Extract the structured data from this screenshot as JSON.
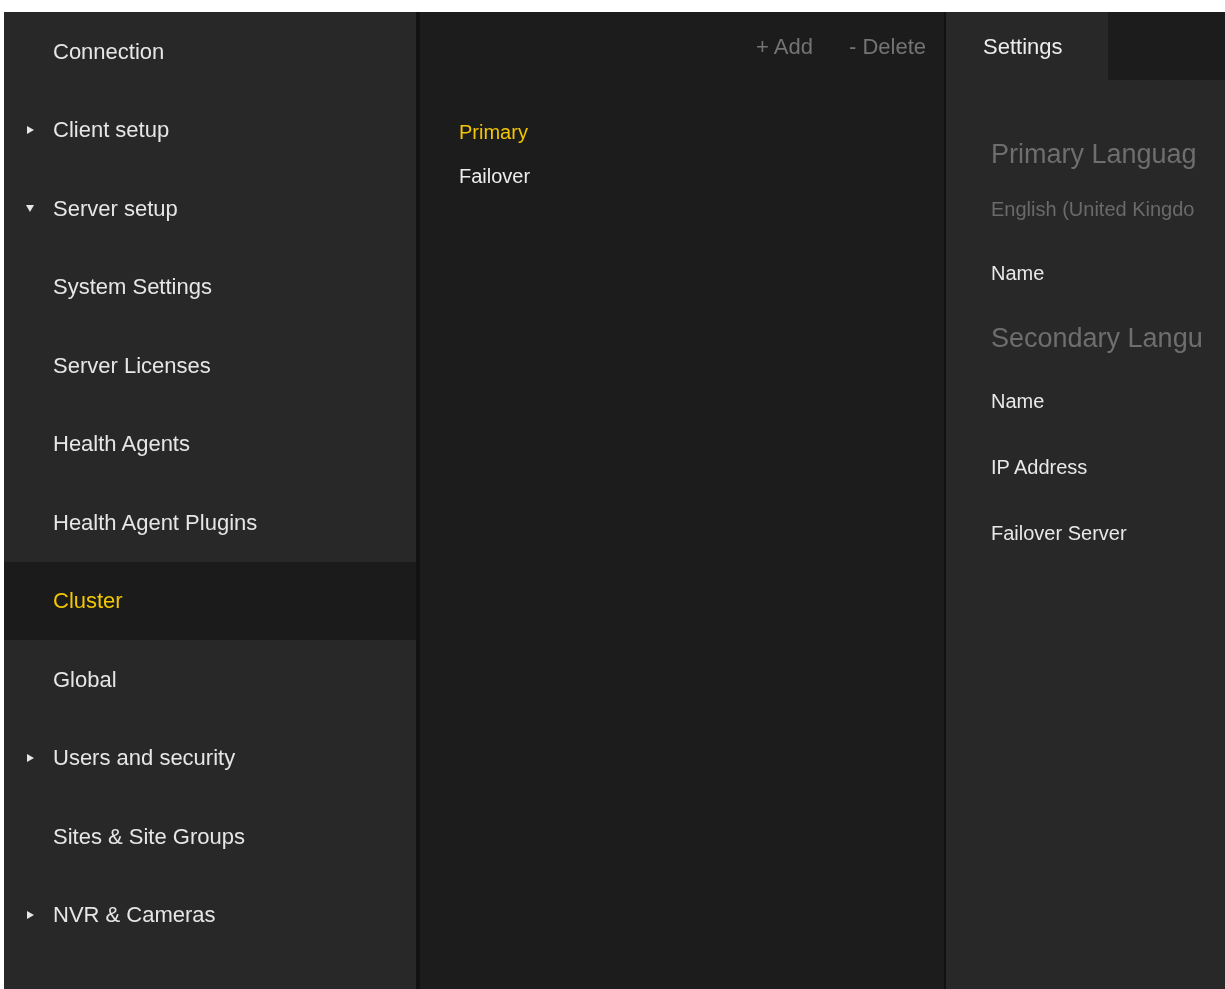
{
  "sidebar": {
    "items": [
      {
        "label": "Connection",
        "kind": "page",
        "selected": false
      },
      {
        "label": "Client setup",
        "kind": "group",
        "expanded": false,
        "selected": false
      },
      {
        "label": "Server setup",
        "kind": "group",
        "expanded": true,
        "selected": false
      },
      {
        "label": "System Settings",
        "kind": "page",
        "selected": false
      },
      {
        "label": "Server Licenses",
        "kind": "page",
        "selected": false
      },
      {
        "label": "Health Agents",
        "kind": "page",
        "selected": false
      },
      {
        "label": "Health Agent Plugins",
        "kind": "page",
        "selected": false
      },
      {
        "label": "Cluster",
        "kind": "page",
        "selected": true
      },
      {
        "label": "Global",
        "kind": "page",
        "selected": false
      },
      {
        "label": "Users and security",
        "kind": "group",
        "expanded": false,
        "selected": false
      },
      {
        "label": "Sites & Site Groups",
        "kind": "page",
        "selected": false
      },
      {
        "label": "NVR & Cameras",
        "kind": "group",
        "expanded": false,
        "selected": false
      }
    ]
  },
  "toolbar": {
    "buttons": [
      "+ Add",
      "- Delete"
    ]
  },
  "nodes": [
    {
      "label": "Primary",
      "selected": true
    },
    {
      "label": "Failover",
      "selected": false
    }
  ],
  "tabs": [
    {
      "label": "Settings",
      "selected": true
    }
  ],
  "settings": [
    {
      "kind": "heading",
      "text": "Primary Languag"
    },
    {
      "kind": "value",
      "text": "English (United Kingdo"
    },
    {
      "kind": "label",
      "text": "Name"
    },
    {
      "kind": "heading",
      "text": "Secondary Langu"
    },
    {
      "kind": "label",
      "text": "Name"
    },
    {
      "kind": "label",
      "text": "IP Address"
    },
    {
      "kind": "label",
      "text": "Failover Server"
    }
  ]
}
